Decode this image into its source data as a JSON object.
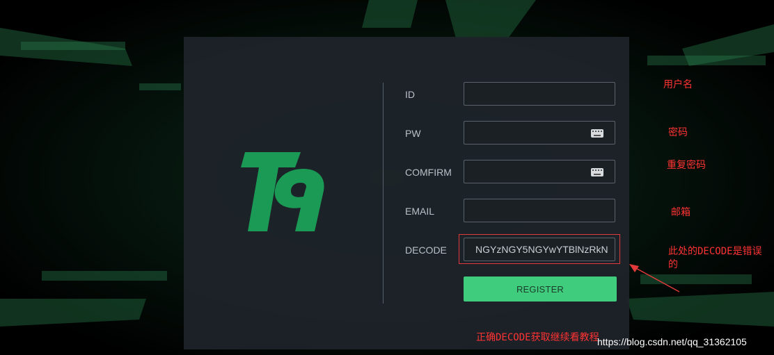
{
  "form": {
    "fields": [
      {
        "label": "ID",
        "value": ""
      },
      {
        "label": "PW",
        "value": ""
      },
      {
        "label": "COMFIRM",
        "value": ""
      },
      {
        "label": "EMAIL",
        "value": ""
      },
      {
        "label": "DECODE",
        "value": "NGYzNGY5NGYwYTBlNzRkN"
      }
    ],
    "register_label": "REGISTER"
  },
  "annotations": {
    "id_note": "用户名",
    "pw_note": "密码",
    "confirm_note": "重复密码",
    "email_note": "邮箱",
    "decode_note_line1": "此处的DECODE是错误",
    "decode_note_line2": "的",
    "bottom_note": "正确DECODE获取继续看教程"
  },
  "watermark": "https://blog.csdn.net/qq_31362105",
  "colors": {
    "accent": "#3fcc7d",
    "logo": "#1a9a55",
    "annotation": "#ff3333"
  },
  "icons": {
    "password_toggle": "keyboard-icon",
    "logo": "t9-logo"
  }
}
